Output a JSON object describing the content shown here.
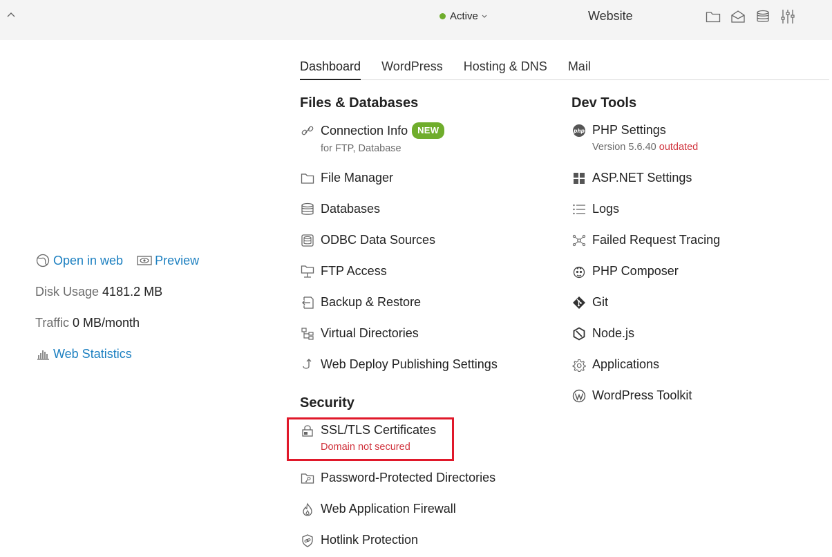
{
  "header": {
    "status_label": "Active",
    "site_type": "Website",
    "icons": [
      "folder-icon",
      "mail-icon",
      "database-icon",
      "sliders-icon"
    ]
  },
  "tabs": [
    {
      "label": "Dashboard",
      "active": true
    },
    {
      "label": "WordPress",
      "active": false
    },
    {
      "label": "Hosting & DNS",
      "active": false
    },
    {
      "label": "Mail",
      "active": false
    }
  ],
  "files_databases": {
    "title": "Files & Databases",
    "connection_info": {
      "label": "Connection Info",
      "badge": "NEW",
      "sub": "for FTP, Database"
    },
    "file_manager": "File Manager",
    "databases": "Databases",
    "odbc": "ODBC Data Sources",
    "ftp": "FTP Access",
    "backup": "Backup & Restore",
    "virtual_dirs": "Virtual Directories",
    "web_deploy": "Web Deploy Publishing Settings"
  },
  "security": {
    "title": "Security",
    "ssl": {
      "label": "SSL/TLS Certificates",
      "sub": "Domain not secured"
    },
    "password_dirs": "Password-Protected Directories",
    "waf": "Web Application Firewall",
    "hotlink": "Hotlink Protection"
  },
  "dev_tools": {
    "title": "Dev Tools",
    "php_settings": {
      "label": "PHP Settings",
      "version": "Version 5.6.40",
      "status": "outdated"
    },
    "aspnet": "ASP.NET Settings",
    "logs": "Logs",
    "failed_request": "Failed Request Tracing",
    "php_composer": "PHP Composer",
    "git": "Git",
    "nodejs": "Node.js",
    "applications": "Applications",
    "wp_toolkit": "WordPress Toolkit"
  },
  "site_info": {
    "open_in_web": "Open in web",
    "preview": "Preview",
    "disk_usage_label": "Disk Usage",
    "disk_usage_value": "4181.2 MB",
    "traffic_label": "Traffic",
    "traffic_value": "0 MB/month",
    "web_statistics": "Web Statistics"
  },
  "colors": {
    "accent_green": "#6fad2c",
    "link_blue": "#1b7fc0",
    "alert_red": "#d0323c",
    "highlight_red": "#e0182a"
  }
}
